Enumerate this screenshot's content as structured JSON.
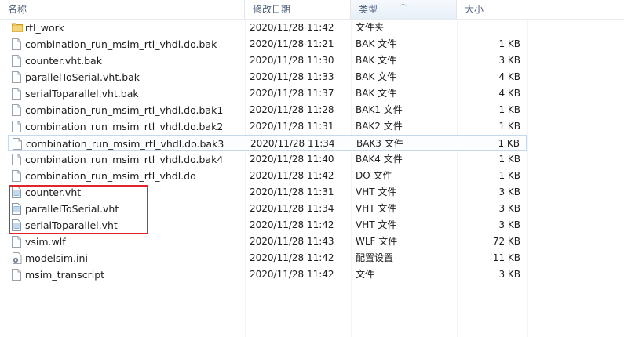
{
  "columns": {
    "name": "名称",
    "date": "修改日期",
    "type": "类型",
    "size": "大小"
  },
  "files": [
    {
      "name": "rtl_work",
      "date": "2020/11/28 11:42",
      "type": "文件夹",
      "size": "",
      "icon": "folder-icon"
    },
    {
      "name": "combination_run_msim_rtl_vhdl.do.bak",
      "date": "2020/11/28 11:21",
      "type": "BAK 文件",
      "size": "1 KB",
      "icon": "file-icon"
    },
    {
      "name": "counter.vht.bak",
      "date": "2020/11/28 11:30",
      "type": "BAK 文件",
      "size": "3 KB",
      "icon": "file-icon"
    },
    {
      "name": "parallelToSerial.vht.bak",
      "date": "2020/11/28 11:33",
      "type": "BAK 文件",
      "size": "4 KB",
      "icon": "file-icon"
    },
    {
      "name": "serialToparallel.vht.bak",
      "date": "2020/11/28 11:37",
      "type": "BAK 文件",
      "size": "4 KB",
      "icon": "file-icon"
    },
    {
      "name": "combination_run_msim_rtl_vhdl.do.bak1",
      "date": "2020/11/28 11:28",
      "type": "BAK1 文件",
      "size": "1 KB",
      "icon": "file-icon"
    },
    {
      "name": "combination_run_msim_rtl_vhdl.do.bak2",
      "date": "2020/11/28 11:31",
      "type": "BAK2 文件",
      "size": "1 KB",
      "icon": "file-icon"
    },
    {
      "name": "combination_run_msim_rtl_vhdl.do.bak3",
      "date": "2020/11/28 11:34",
      "type": "BAK3 文件",
      "size": "1 KB",
      "icon": "file-icon"
    },
    {
      "name": "combination_run_msim_rtl_vhdl.do.bak4",
      "date": "2020/11/28 11:40",
      "type": "BAK4 文件",
      "size": "1 KB",
      "icon": "file-icon"
    },
    {
      "name": "combination_run_msim_rtl_vhdl.do",
      "date": "2020/11/28 11:42",
      "type": "DO 文件",
      "size": "1 KB",
      "icon": "file-icon"
    },
    {
      "name": "counter.vht",
      "date": "2020/11/28 11:31",
      "type": "VHT 文件",
      "size": "3 KB",
      "icon": "text-file-icon"
    },
    {
      "name": "parallelToSerial.vht",
      "date": "2020/11/28 11:34",
      "type": "VHT 文件",
      "size": "3 KB",
      "icon": "text-file-icon"
    },
    {
      "name": "serialToparallel.vht",
      "date": "2020/11/28 11:42",
      "type": "VHT 文件",
      "size": "3 KB",
      "icon": "text-file-icon"
    },
    {
      "name": "vsim.wlf",
      "date": "2020/11/28 11:43",
      "type": "WLF 文件",
      "size": "72 KB",
      "icon": "file-icon"
    },
    {
      "name": "modelsim.ini",
      "date": "2020/11/28 11:42",
      "type": "配置设置",
      "size": "11 KB",
      "icon": "settings-file-icon"
    },
    {
      "name": "msim_transcript",
      "date": "2020/11/28 11:42",
      "type": "文件",
      "size": "3 KB",
      "icon": "file-icon"
    }
  ],
  "selected_index": 7,
  "highlight_color": "#e0252c"
}
